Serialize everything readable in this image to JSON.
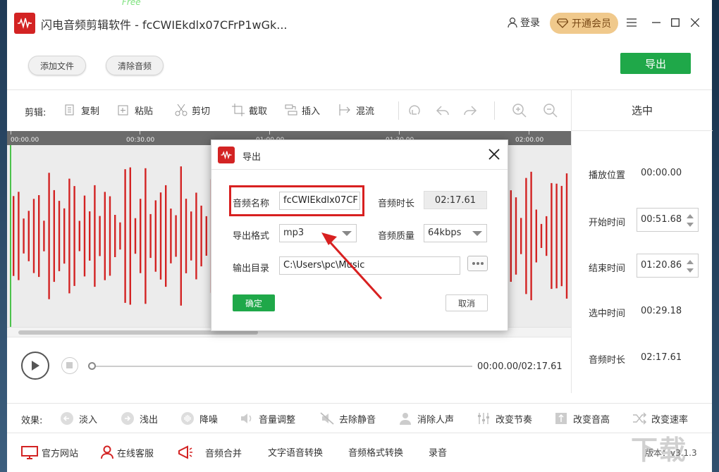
{
  "titlebar": {
    "title": "闪电音频剪辑软件 - fcCWIEkdlx07CFrP1wGk...",
    "login_label": "登录",
    "vip_label": "开通会员",
    "free_tag": "Free"
  },
  "toolbar": {
    "add_file_label": "添加文件",
    "clear_audio_label": "清除音频",
    "export_label": "导出"
  },
  "edit": {
    "label": "剪辑:",
    "tools": [
      {
        "label": "复制",
        "icon": "copy-icon"
      },
      {
        "label": "粘贴",
        "icon": "paste-icon"
      },
      {
        "label": "剪切",
        "icon": "cut-icon"
      },
      {
        "label": "截取",
        "icon": "crop-icon"
      },
      {
        "label": "插入",
        "icon": "insert-icon"
      },
      {
        "label": "混流",
        "icon": "mix-icon"
      }
    ]
  },
  "right_panel": {
    "header": "选中",
    "play_pos_label": "播放位置",
    "play_pos_value": "00:00.00",
    "start_label": "开始时间",
    "start_value": "00:51.68",
    "end_label": "结束时间",
    "end_value": "01:20.86",
    "selected_label": "选中时间",
    "selected_value": "00:29.18",
    "duration_label": "音频时长",
    "duration_value": "02:17.61"
  },
  "timeline": {
    "ticks": [
      "00:00.00",
      "00:30.00",
      "01:00.00",
      "01:30.00",
      "02:00.00"
    ]
  },
  "player": {
    "time_readout": "00:00.00/02:17.61",
    "progress": 0
  },
  "effects": {
    "label": "效果:",
    "items": [
      {
        "label": "淡入",
        "icon": "fade-in-icon"
      },
      {
        "label": "浅出",
        "icon": "fade-out-icon"
      },
      {
        "label": "降噪",
        "icon": "denoise-icon"
      },
      {
        "label": "音量调整",
        "icon": "volume-icon"
      },
      {
        "label": "去除静音",
        "icon": "mute-remove-icon"
      },
      {
        "label": "消除人声",
        "icon": "vocal-remove-icon"
      },
      {
        "label": "改变节奏",
        "icon": "tempo-icon"
      },
      {
        "label": "改变音高",
        "icon": "pitch-icon"
      },
      {
        "label": "改变速率",
        "icon": "speed-icon"
      }
    ]
  },
  "links": {
    "items": [
      {
        "label": "官方网站",
        "icon": "monitor-icon"
      },
      {
        "label": "在线客服",
        "icon": "user-icon"
      },
      {
        "label": "音频合并",
        "icon": "megaphone-icon"
      },
      {
        "label": "文字语音转换"
      },
      {
        "label": "音频格式转换"
      },
      {
        "label": "录音"
      }
    ],
    "version": "版本：v3.1.3"
  },
  "dialog": {
    "title": "导出",
    "name_label": "音频名称",
    "name_value": "fcCWIEkdlx07CF",
    "duration_label": "音频时长",
    "duration_value": "02:17.61",
    "format_label": "导出格式",
    "format_value": "mp3",
    "quality_label": "音频质量",
    "quality_value": "64kbps",
    "dir_label": "输出目录",
    "dir_value": "C:\\Users\\pc\\Music",
    "ok_label": "确定",
    "cancel_label": "取消"
  },
  "colors": {
    "accent_green": "#1fa849",
    "wave_red": "#d32323",
    "vip_gold": "#f0c98c",
    "highlight_red": "#d82020"
  }
}
